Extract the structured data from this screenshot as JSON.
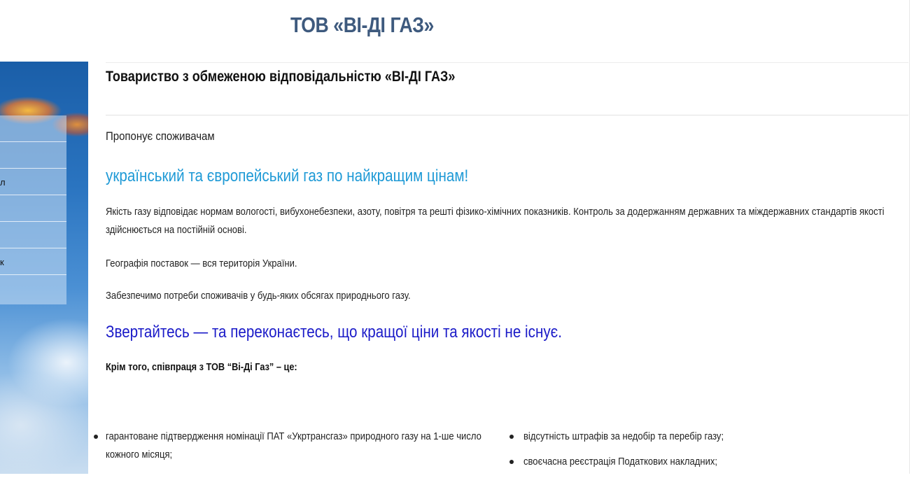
{
  "header": {
    "site_title": "ТОВ «ВІ-ДІ ГАЗ»"
  },
  "sidebar": {
    "menu_items": [
      {
        "label": ""
      },
      {
        "label": ""
      },
      {
        "label": "л"
      },
      {
        "label": ""
      },
      {
        "label": ""
      },
      {
        "label": "к"
      },
      {
        "label": ""
      }
    ]
  },
  "main": {
    "heading": "Товариство з обмеженою відповідальністю «ВІ-ДІ ГАЗ»",
    "intro": "Пропонує споживачам",
    "slogan": "український та європейський газ по найкращим цінам!",
    "quality_text": "Якість газу відповідає нормам вологості, вибухонебезпеки, азоту, повітря та решті фізико-хімічних показників. Контроль за додержанням державних та міждержавних стандартів якості здійснюється на постійній основі.",
    "geography_text": "Географія поставок — вся територія України.",
    "supply_text": "Забезпечимо потреби споживачів у будь-яких обсягах природнього газу.",
    "callout": "Звертайтесь — та переконаєтесь, що кращої ціни та якості не існує.",
    "benefits_heading": "Крім того, співпраця з ТОВ “Ві-Ді Газ” – це:",
    "benefits_left": [
      " гарантоване підтвердження номінації ПАТ «Укртрансгаз» природного газу на 1-ше число кожного місяця;"
    ],
    "benefits_right": [
      "відсутність штрафів за недобір та перебір газу;",
      "своєчасна реєстрація Податкових накладних;"
    ]
  }
}
